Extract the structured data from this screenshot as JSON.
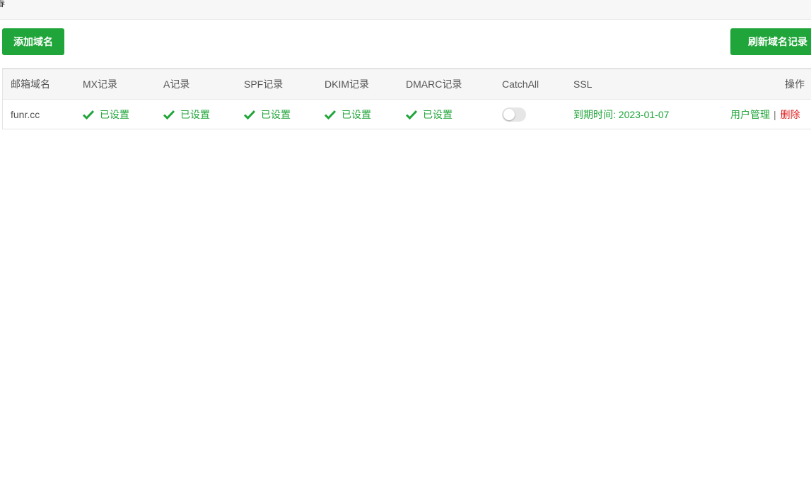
{
  "topbar": {
    "glyph": "春"
  },
  "toolbar": {
    "add_label": "添加域名",
    "refresh_label": "刷新域名记录"
  },
  "colors": {
    "accent": "#20a53a",
    "danger": "#e02020"
  },
  "table": {
    "columns": [
      "邮箱域名",
      "MX记录",
      "A记录",
      "SPF记录",
      "DKIM记录",
      "DMARC记录",
      "CatchAll",
      "SSL",
      "操作"
    ],
    "rows": [
      {
        "domain": "funr.cc",
        "mx": "已设置",
        "a": "已设置",
        "spf": "已设置",
        "dkim": "已设置",
        "dmarc": "已设置",
        "catchall_on": false,
        "ssl": "到期时间: 2023-01-07",
        "actions": {
          "users": "用户管理",
          "separator": "|",
          "delete": "删除"
        }
      }
    ]
  },
  "icons": {
    "status": "check-icon"
  }
}
